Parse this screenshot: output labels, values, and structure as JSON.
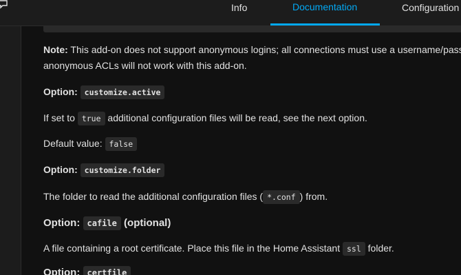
{
  "header": {
    "tabs": [
      {
        "label": "Info"
      },
      {
        "label": "Documentation"
      },
      {
        "label": "Configuration"
      }
    ],
    "icon": "feedback-icon"
  },
  "doc": {
    "note": {
      "label": "Note:",
      "text_line1": " This add-on does not support anonymous logins; all connections must use a username/password.",
      "text_line2": "anonymous ACLs will not work with this add-on."
    },
    "option1": {
      "label": "Option:",
      "code": "customize.active",
      "desc_before": "If set to ",
      "desc_code": "true",
      "desc_after": " additional configuration files will be read, see the next option.",
      "default_label": "Default value: ",
      "default_code": "false"
    },
    "option2": {
      "label": "Option:",
      "code": "customize.folder",
      "desc_before": "The folder to read the additional configuration files (",
      "desc_code": "*.conf",
      "desc_after": ") from."
    },
    "option3": {
      "label": "Option:",
      "code": "cafile",
      "suffix": "(optional)",
      "desc_before": "A file containing a root certificate. Place this file in the Home Assistant ",
      "desc_code": "ssl",
      "desc_after": " folder."
    },
    "option4": {
      "label": "Option:",
      "code": "certfile"
    }
  }
}
